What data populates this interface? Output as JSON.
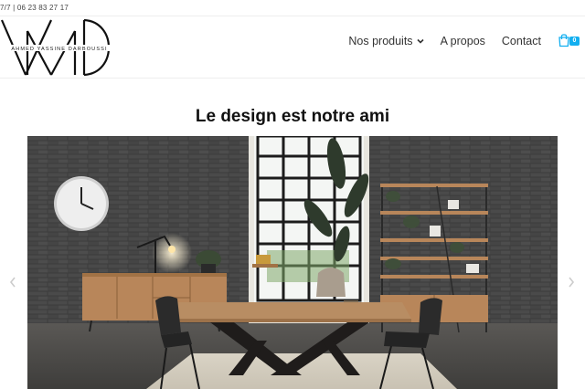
{
  "topbar": {
    "text": "7/7 | 06 23 83 27 17"
  },
  "logo": {
    "monogram": "AMD",
    "tagline": "AHMED YASSINE DARBOUSSI"
  },
  "nav": {
    "items": [
      {
        "label": "Nos produits",
        "has_dropdown": true
      },
      {
        "label": "A propos"
      },
      {
        "label": "Contact"
      }
    ],
    "cart_count": "0"
  },
  "main": {
    "headline": "Le design est notre ami"
  },
  "hero": {
    "image": "dining room with wooden table, two chairs, wall clock and metal shelving"
  },
  "colors": {
    "accent": "#13aff0",
    "text": "#333333"
  },
  "icons": [
    "chevron-down-icon",
    "shopping-bag-icon",
    "chevron-left-icon",
    "chevron-right-icon"
  ]
}
